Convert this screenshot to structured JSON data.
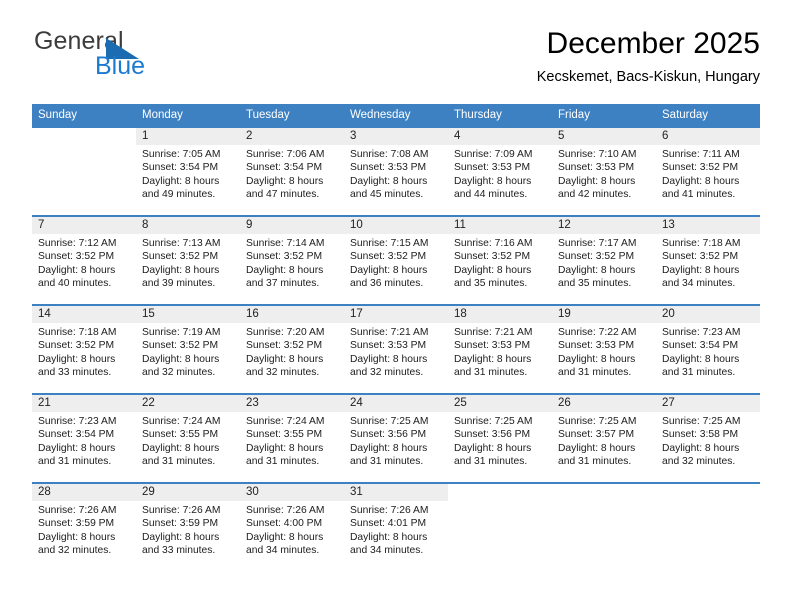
{
  "brand": {
    "name_part1": "General",
    "name_part2": "Blue",
    "triangle_icon": "triangle-icon",
    "color_dark": "#3c3c3c",
    "color_blue": "#1b7ad1"
  },
  "header": {
    "title": "December 2025",
    "subtitle": "Kecskemet, Bacs-Kiskun, Hungary"
  },
  "theme": {
    "header_blue": "#3d81c2",
    "daynum_band": "#eeeeee",
    "text": "#202020"
  },
  "weekdays": [
    "Sunday",
    "Monday",
    "Tuesday",
    "Wednesday",
    "Thursday",
    "Friday",
    "Saturday"
  ],
  "weeks": [
    [
      {
        "day": "",
        "lines": [
          "",
          "",
          "",
          ""
        ]
      },
      {
        "day": "1",
        "lines": [
          "Sunrise: 7:05 AM",
          "Sunset: 3:54 PM",
          "Daylight: 8 hours",
          "and 49 minutes."
        ]
      },
      {
        "day": "2",
        "lines": [
          "Sunrise: 7:06 AM",
          "Sunset: 3:54 PM",
          "Daylight: 8 hours",
          "and 47 minutes."
        ]
      },
      {
        "day": "3",
        "lines": [
          "Sunrise: 7:08 AM",
          "Sunset: 3:53 PM",
          "Daylight: 8 hours",
          "and 45 minutes."
        ]
      },
      {
        "day": "4",
        "lines": [
          "Sunrise: 7:09 AM",
          "Sunset: 3:53 PM",
          "Daylight: 8 hours",
          "and 44 minutes."
        ]
      },
      {
        "day": "5",
        "lines": [
          "Sunrise: 7:10 AM",
          "Sunset: 3:53 PM",
          "Daylight: 8 hours",
          "and 42 minutes."
        ]
      },
      {
        "day": "6",
        "lines": [
          "Sunrise: 7:11 AM",
          "Sunset: 3:52 PM",
          "Daylight: 8 hours",
          "and 41 minutes."
        ]
      }
    ],
    [
      {
        "day": "7",
        "lines": [
          "Sunrise: 7:12 AM",
          "Sunset: 3:52 PM",
          "Daylight: 8 hours",
          "and 40 minutes."
        ]
      },
      {
        "day": "8",
        "lines": [
          "Sunrise: 7:13 AM",
          "Sunset: 3:52 PM",
          "Daylight: 8 hours",
          "and 39 minutes."
        ]
      },
      {
        "day": "9",
        "lines": [
          "Sunrise: 7:14 AM",
          "Sunset: 3:52 PM",
          "Daylight: 8 hours",
          "and 37 minutes."
        ]
      },
      {
        "day": "10",
        "lines": [
          "Sunrise: 7:15 AM",
          "Sunset: 3:52 PM",
          "Daylight: 8 hours",
          "and 36 minutes."
        ]
      },
      {
        "day": "11",
        "lines": [
          "Sunrise: 7:16 AM",
          "Sunset: 3:52 PM",
          "Daylight: 8 hours",
          "and 35 minutes."
        ]
      },
      {
        "day": "12",
        "lines": [
          "Sunrise: 7:17 AM",
          "Sunset: 3:52 PM",
          "Daylight: 8 hours",
          "and 35 minutes."
        ]
      },
      {
        "day": "13",
        "lines": [
          "Sunrise: 7:18 AM",
          "Sunset: 3:52 PM",
          "Daylight: 8 hours",
          "and 34 minutes."
        ]
      }
    ],
    [
      {
        "day": "14",
        "lines": [
          "Sunrise: 7:18 AM",
          "Sunset: 3:52 PM",
          "Daylight: 8 hours",
          "and 33 minutes."
        ]
      },
      {
        "day": "15",
        "lines": [
          "Sunrise: 7:19 AM",
          "Sunset: 3:52 PM",
          "Daylight: 8 hours",
          "and 32 minutes."
        ]
      },
      {
        "day": "16",
        "lines": [
          "Sunrise: 7:20 AM",
          "Sunset: 3:52 PM",
          "Daylight: 8 hours",
          "and 32 minutes."
        ]
      },
      {
        "day": "17",
        "lines": [
          "Sunrise: 7:21 AM",
          "Sunset: 3:53 PM",
          "Daylight: 8 hours",
          "and 32 minutes."
        ]
      },
      {
        "day": "18",
        "lines": [
          "Sunrise: 7:21 AM",
          "Sunset: 3:53 PM",
          "Daylight: 8 hours",
          "and 31 minutes."
        ]
      },
      {
        "day": "19",
        "lines": [
          "Sunrise: 7:22 AM",
          "Sunset: 3:53 PM",
          "Daylight: 8 hours",
          "and 31 minutes."
        ]
      },
      {
        "day": "20",
        "lines": [
          "Sunrise: 7:23 AM",
          "Sunset: 3:54 PM",
          "Daylight: 8 hours",
          "and 31 minutes."
        ]
      }
    ],
    [
      {
        "day": "21",
        "lines": [
          "Sunrise: 7:23 AM",
          "Sunset: 3:54 PM",
          "Daylight: 8 hours",
          "and 31 minutes."
        ]
      },
      {
        "day": "22",
        "lines": [
          "Sunrise: 7:24 AM",
          "Sunset: 3:55 PM",
          "Daylight: 8 hours",
          "and 31 minutes."
        ]
      },
      {
        "day": "23",
        "lines": [
          "Sunrise: 7:24 AM",
          "Sunset: 3:55 PM",
          "Daylight: 8 hours",
          "and 31 minutes."
        ]
      },
      {
        "day": "24",
        "lines": [
          "Sunrise: 7:25 AM",
          "Sunset: 3:56 PM",
          "Daylight: 8 hours",
          "and 31 minutes."
        ]
      },
      {
        "day": "25",
        "lines": [
          "Sunrise: 7:25 AM",
          "Sunset: 3:56 PM",
          "Daylight: 8 hours",
          "and 31 minutes."
        ]
      },
      {
        "day": "26",
        "lines": [
          "Sunrise: 7:25 AM",
          "Sunset: 3:57 PM",
          "Daylight: 8 hours",
          "and 31 minutes."
        ]
      },
      {
        "day": "27",
        "lines": [
          "Sunrise: 7:25 AM",
          "Sunset: 3:58 PM",
          "Daylight: 8 hours",
          "and 32 minutes."
        ]
      }
    ],
    [
      {
        "day": "28",
        "lines": [
          "Sunrise: 7:26 AM",
          "Sunset: 3:59 PM",
          "Daylight: 8 hours",
          "and 32 minutes."
        ]
      },
      {
        "day": "29",
        "lines": [
          "Sunrise: 7:26 AM",
          "Sunset: 3:59 PM",
          "Daylight: 8 hours",
          "and 33 minutes."
        ]
      },
      {
        "day": "30",
        "lines": [
          "Sunrise: 7:26 AM",
          "Sunset: 4:00 PM",
          "Daylight: 8 hours",
          "and 34 minutes."
        ]
      },
      {
        "day": "31",
        "lines": [
          "Sunrise: 7:26 AM",
          "Sunset: 4:01 PM",
          "Daylight: 8 hours",
          "and 34 minutes."
        ]
      },
      {
        "day": "",
        "lines": [
          "",
          "",
          "",
          ""
        ]
      },
      {
        "day": "",
        "lines": [
          "",
          "",
          "",
          ""
        ]
      },
      {
        "day": "",
        "lines": [
          "",
          "",
          "",
          ""
        ]
      }
    ]
  ]
}
